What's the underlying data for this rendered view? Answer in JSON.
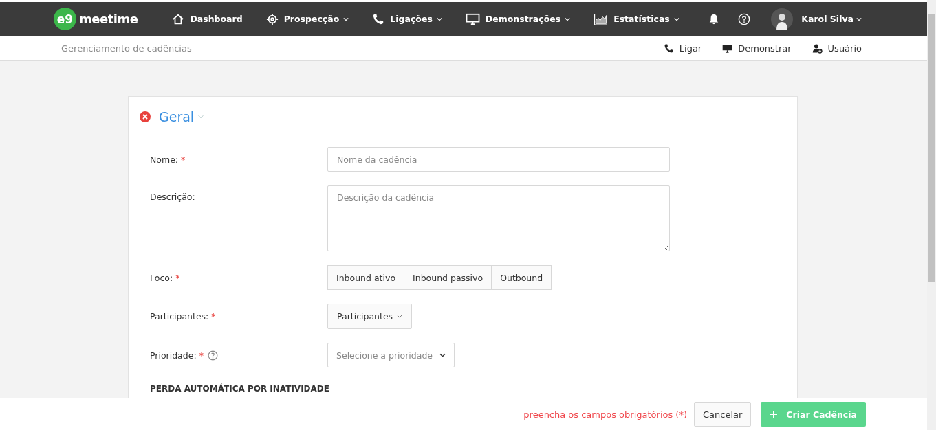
{
  "navbar": {
    "logo": {
      "mark": "e9",
      "name": "meetime"
    },
    "items": [
      {
        "label": "Dashboard",
        "kind": "home",
        "dropdown": false
      },
      {
        "label": "Prospecção",
        "kind": "target",
        "dropdown": true
      },
      {
        "label": "Ligações",
        "kind": "phone",
        "dropdown": true
      },
      {
        "label": "Demonstrações",
        "kind": "monitor",
        "dropdown": true
      },
      {
        "label": "Estatísticas",
        "kind": "chart",
        "dropdown": true
      }
    ],
    "user": {
      "name": "Karol Silva"
    }
  },
  "subbar": {
    "title": "Gerenciamento de cadências",
    "actions": [
      {
        "label": "Ligar",
        "kind": "phone"
      },
      {
        "label": "Demonstrar",
        "kind": "monitor"
      },
      {
        "label": "Usuário",
        "kind": "user"
      }
    ]
  },
  "section": {
    "title": "Geral",
    "invalid": true,
    "fields": [
      {
        "kind": "text",
        "label": "Nome:",
        "required_mark": "*",
        "placeholder": "Nome da cadência"
      },
      {
        "kind": "textarea",
        "label": "Descrição:",
        "placeholder": "Descrição da cadência"
      },
      {
        "kind": "segmented",
        "label": "Foco:",
        "required_mark": "*",
        "options": [
          {
            "label": "Inbound ativo",
            "selected": false
          },
          {
            "label": "Inbound passivo",
            "selected": false
          },
          {
            "label": "Outbound",
            "selected": false
          }
        ]
      },
      {
        "kind": "dropdown",
        "label": "Participantes:",
        "required_mark": "*",
        "value": "Participantes"
      },
      {
        "kind": "select",
        "label": "Prioridade:",
        "required_mark": "*",
        "help": true,
        "placeholder": "Selecione a prioridade"
      }
    ],
    "subheading": "PERDA AUTOMÁTICA POR INATIVIDADE"
  },
  "footer": {
    "message": "preencha os campos obrigatórios (*)",
    "cancel": "Cancelar",
    "submit": "Criar Cadência"
  }
}
